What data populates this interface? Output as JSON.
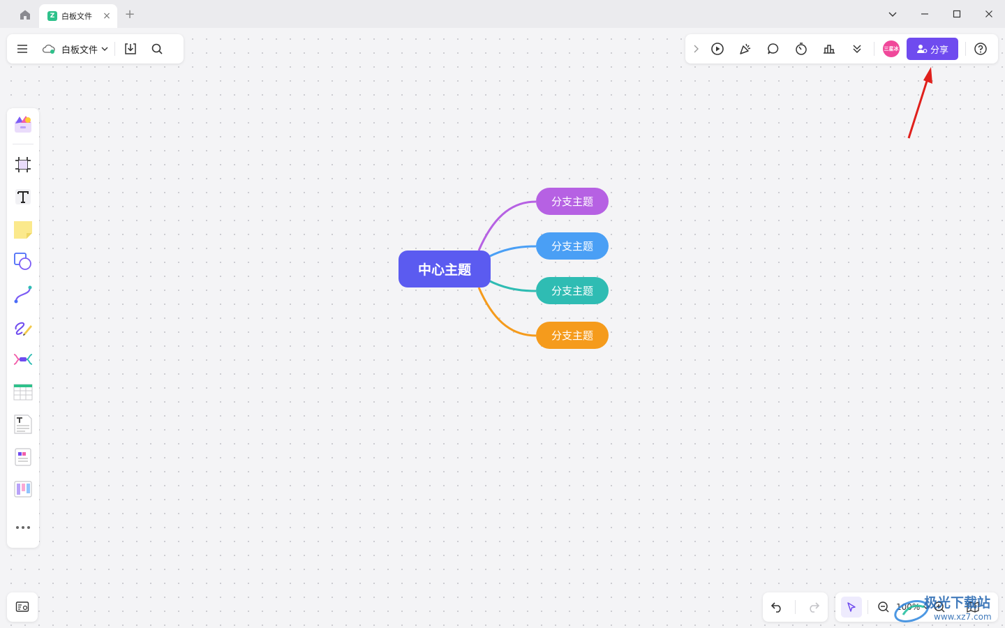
{
  "tab": {
    "title": "白板文件",
    "logo_glyph": "Z"
  },
  "file": {
    "name": "白板文件",
    "cloud_icon": "cloud-check-icon"
  },
  "toolbar_right": {
    "avatar_text": "三星冰",
    "share_label": "分享"
  },
  "mindmap": {
    "central_topic": "中心主题",
    "branches": [
      {
        "label": "分支主题",
        "color": "#b661e3"
      },
      {
        "label": "分支主题",
        "color": "#4a9ff5"
      },
      {
        "label": "分支主题",
        "color": "#2fbcb3"
      },
      {
        "label": "分支主题",
        "color": "#f59b1c"
      }
    ]
  },
  "zoom": {
    "level": "100%"
  },
  "watermark": {
    "text": "极光下载站",
    "url": "www.xz7.com"
  },
  "colors": {
    "accent": "#6f4bef",
    "central": "#5b5bf0",
    "arrow": "#e0201c"
  }
}
